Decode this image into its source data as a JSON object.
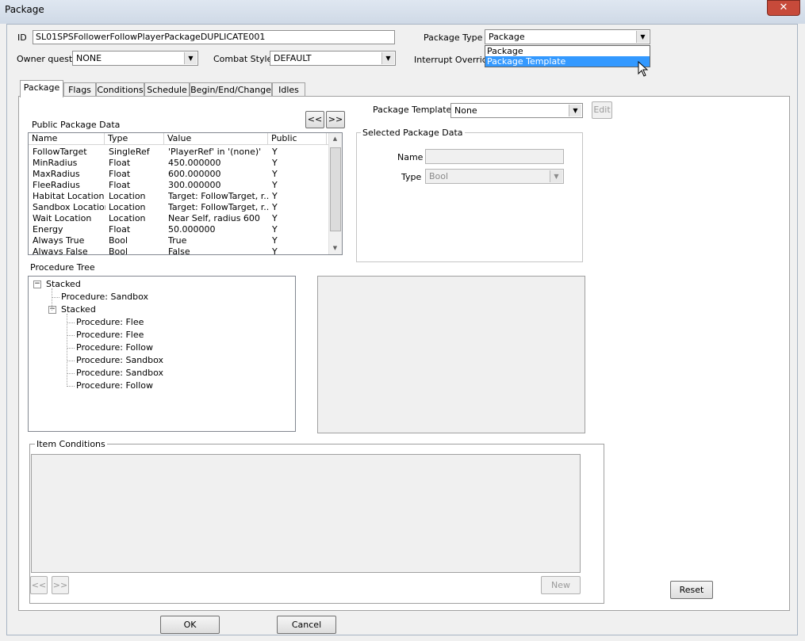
{
  "window": {
    "title": "Package",
    "close_glyph": "✕"
  },
  "form": {
    "id_label": "ID",
    "id_value": "SL01SPSFollowerFollowPlayerPackageDUPLICATE001",
    "owner_quest_label": "Owner quest",
    "owner_quest_value": "NONE",
    "combat_style_label": "Combat Style",
    "combat_style_value": "DEFAULT",
    "package_type_label": "Package Type",
    "package_type_value": "Package",
    "package_type_options": [
      "Package",
      "Package Template"
    ],
    "interrupt_override_label": "Interrupt Override"
  },
  "tabs": [
    "Package",
    "Flags",
    "Conditions",
    "Schedule",
    "Begin/End/Change",
    "Idles"
  ],
  "package_tab": {
    "package_template_label": "Package Template",
    "package_template_value": "None",
    "edit_button": "Edit",
    "nav_prev": "<<",
    "nav_next": ">>",
    "public_data_title": "Public Package Data",
    "columns": [
      "Name",
      "Type",
      "Value",
      "Public"
    ],
    "rows": [
      [
        "FollowTarget",
        "SingleRef",
        "'PlayerRef' in '(none)'",
        "Y"
      ],
      [
        "MinRadius",
        "Float",
        "450.000000",
        "Y"
      ],
      [
        "MaxRadius",
        "Float",
        "600.000000",
        "Y"
      ],
      [
        "FleeRadius",
        "Float",
        "300.000000",
        "Y"
      ],
      [
        "Habitat Location",
        "Location",
        "Target: FollowTarget, r...",
        "Y"
      ],
      [
        "Sandbox Location",
        "Location",
        "Target: FollowTarget, r...",
        "Y"
      ],
      [
        "Wait Location",
        "Location",
        "Near Self, radius 600",
        "Y"
      ],
      [
        "Energy",
        "Float",
        "50.000000",
        "Y"
      ],
      [
        "Always True",
        "Bool",
        "True",
        "Y"
      ],
      [
        "Always False",
        "Bool",
        "False",
        "Y"
      ]
    ],
    "selected_data_title": "Selected Package Data",
    "name_label": "Name",
    "name_value": "",
    "type_label": "Type",
    "type_value": "Bool",
    "procedure_tree_title": "Procedure Tree",
    "tree": [
      {
        "text": "Stacked",
        "level": 0,
        "expander": "−"
      },
      {
        "text": "Procedure: Sandbox",
        "level": 1
      },
      {
        "text": "Stacked",
        "level": 1,
        "expander": "−"
      },
      {
        "text": "Procedure: Flee",
        "level": 2
      },
      {
        "text": "Procedure: Flee",
        "level": 2
      },
      {
        "text": "Procedure: Follow",
        "level": 2
      },
      {
        "text": "Procedure: Sandbox",
        "level": 2
      },
      {
        "text": "Procedure: Sandbox",
        "level": 2
      },
      {
        "text": "Procedure: Follow",
        "level": 2
      }
    ],
    "item_conditions_title": "Item Conditions",
    "new_button": "New",
    "reset_button": "Reset"
  },
  "footer": {
    "ok": "OK",
    "cancel": "Cancel"
  }
}
